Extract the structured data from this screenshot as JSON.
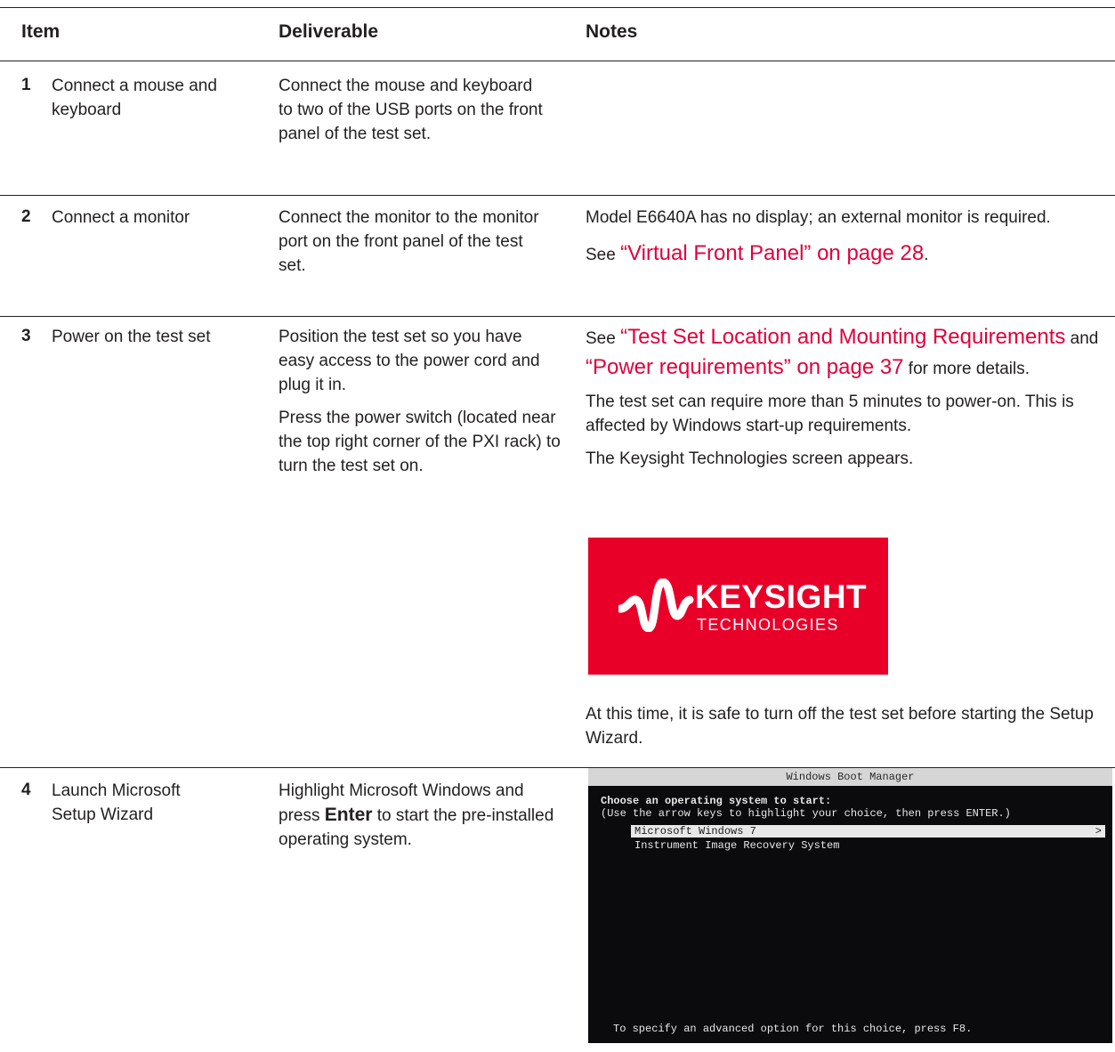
{
  "header": {
    "item": "Item",
    "deliverable": "Deliverable",
    "notes": "Notes"
  },
  "rows": [
    {
      "num": "1",
      "item": "Connect a mouse and keyboard",
      "deliverable": [
        "Connect the mouse and keyboard to two of the USB ports on the front panel of the test set."
      ]
    },
    {
      "num": "2",
      "item": "Connect a monitor",
      "deliverable": [
        "Connect the monitor to the monitor port on the front panel of the test set."
      ],
      "notes_1": "Model E6640A has no display; an external monitor is required.",
      "notes_2_prefix": "See ",
      "notes_2_link": "“Virtual Front Panel” on page 28",
      "notes_2_suffix": "."
    },
    {
      "num": "3",
      "item": "Power on the test set",
      "deliverable": [
        "Position the test set so you have easy access to the power cord and plug it in.",
        "Press the power switch (located near the top right corner of the PXI rack) to turn the test set on."
      ],
      "notes_see": "See ",
      "notes_link1": "“Test Set Location and Mounting Requirements",
      "notes_and": " and ",
      "notes_link2": "“Power requirements” on page 37",
      "notes_details": " for more details.",
      "notes_2": "The test set can require more than 5 minutes to power-on. This is affected by Windows start-up requirements.",
      "notes_3": "The Keysight Technologies screen appears.",
      "notes_4": "At this time, it is safe to turn off the test set before starting the Setup Wizard.",
      "logo": {
        "name": "KEYSIGHT",
        "sub": "TECHNOLOGIES",
        "brand_color": "#e90029"
      }
    },
    {
      "num": "4",
      "item": "Launch Microsoft Setup Wizard",
      "deliverable_pre": "Highlight Microsoft Windows and press ",
      "deliverable_key": "Enter",
      "deliverable_post": " to start the pre-installed operating system.",
      "boot": {
        "title": "Windows Boot Manager",
        "line1": "Choose an operating system to start:",
        "line2": "(Use the arrow keys to highlight your choice, then press ENTER.)",
        "selected": "Microsoft Windows 7",
        "arrow": ">",
        "option2": "Instrument Image Recovery System",
        "footer": "To specify an advanced option for this choice, press F8."
      }
    }
  ],
  "colors": {
    "link": "#e0003c",
    "text": "#231f20"
  }
}
